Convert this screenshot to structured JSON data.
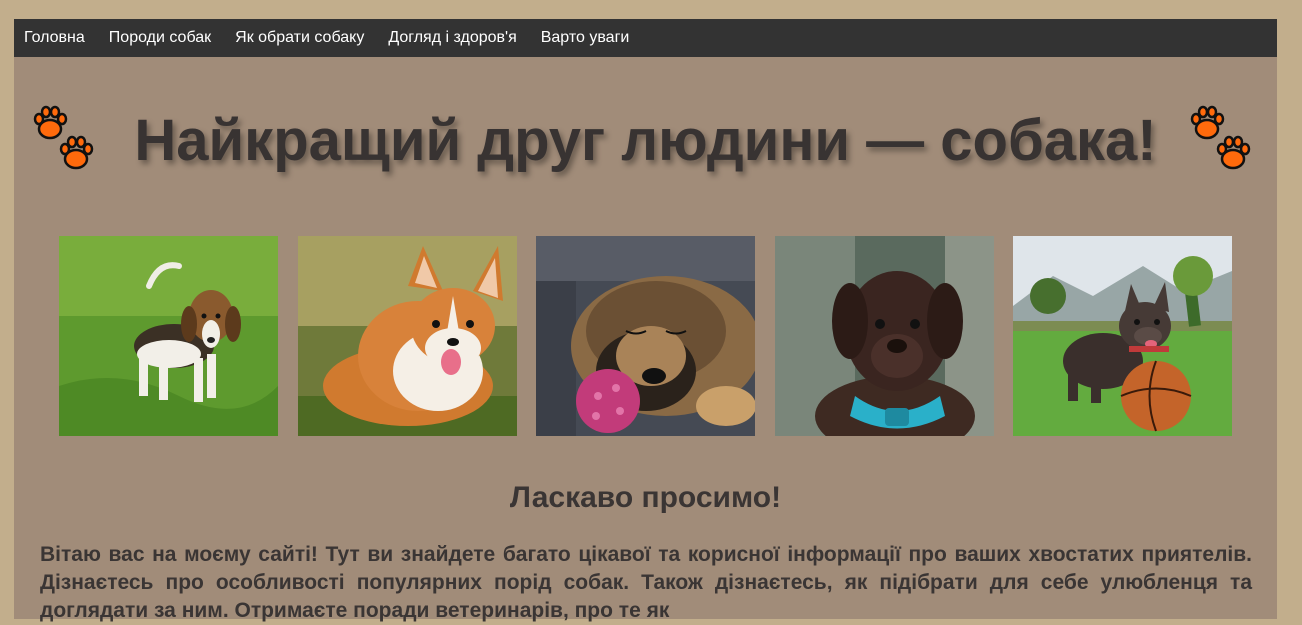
{
  "nav": {
    "items": [
      {
        "label": "Головна"
      },
      {
        "label": "Породи собак"
      },
      {
        "label": "Як обрати собаку"
      },
      {
        "label": "Догляд і здоров'я"
      },
      {
        "label": "Варто уваги"
      }
    ]
  },
  "header": {
    "title": "Найкращий друг людини — собака!",
    "decoration_icon": "paw-prints-icon",
    "paw_color": "#ff6a0c"
  },
  "gallery": {
    "photos": [
      {
        "subject": "beagle-puppy"
      },
      {
        "subject": "corgi"
      },
      {
        "subject": "sleeping-shepherd"
      },
      {
        "subject": "chocolate-labrador-puppy"
      },
      {
        "subject": "french-bulldog-with-ball"
      }
    ]
  },
  "main": {
    "welcome_heading": "Ласкаво просимо!",
    "intro_text": "Вітаю вас на моєму сайті! Тут ви знайдете багато цікавої та корисної інформації про ваших хвостатих приятелів. Дізнаєтесь про особливості популярних порід собак. Також дізнаєтесь, як підібрати для себе улюбленця та доглядати за ним. Отримаєте поради ветеринарів, про те як"
  },
  "colors": {
    "background": "#c2ae8c",
    "content": "#a18c79",
    "navbar": "#333333",
    "text": "#383332"
  }
}
